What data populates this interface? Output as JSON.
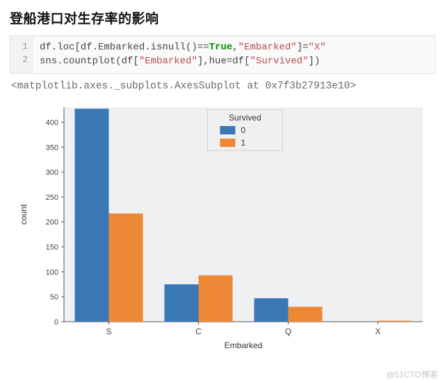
{
  "heading": "登船港口对生存率的影响",
  "code": {
    "lineno": [
      "1",
      "2"
    ],
    "l1_a": "df.loc[df.Embarked.isnull()",
    "l1_eq": "==",
    "l1_true": "True",
    "l1_b": ",",
    "l1_s1": "\"Embarked\"",
    "l1_c": "]=",
    "l1_s2": "\"X\"",
    "l2_a": "sns.countplot(df[",
    "l2_s1": "\"Embarked\"",
    "l2_b": "],hue=df[",
    "l2_s2": "\"Survived\"",
    "l2_c": "])"
  },
  "output_repr": "<matplotlib.axes._subplots.AxesSubplot at 0x7f3b27913e10>",
  "chart_data": {
    "type": "bar",
    "categories": [
      "S",
      "C",
      "Q",
      "X"
    ],
    "series": [
      {
        "name": "0",
        "values": [
          427,
          75,
          47,
          0
        ],
        "color": "#3a78b5"
      },
      {
        "name": "1",
        "values": [
          217,
          93,
          30,
          2
        ],
        "color": "#ed8936"
      }
    ],
    "title": "",
    "xlabel": "Embarked",
    "ylabel": "count",
    "ylim": [
      0,
      430
    ],
    "yticks": [
      0,
      50,
      100,
      150,
      200,
      250,
      300,
      350,
      400
    ],
    "legend": {
      "title": "Survived",
      "position": "top-center-right"
    },
    "grid": false
  },
  "watermark": "@51CTO博客"
}
